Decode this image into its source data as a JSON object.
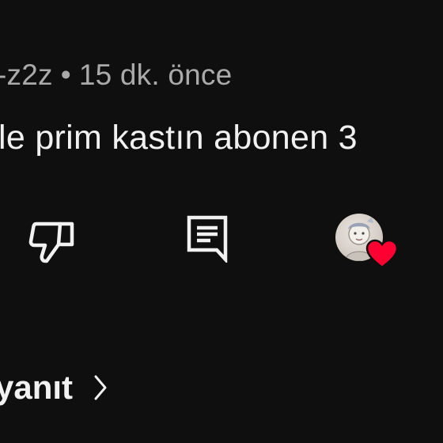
{
  "comment": {
    "author": "-z2z",
    "separator": "•",
    "time": "15 dk. önce",
    "text": "le prim kastın abonen 3"
  },
  "actions": {
    "dislike_icon": "thumbs-down-icon",
    "reply_icon": "comment-icon",
    "creator_heart_icon": "heart-icon",
    "heart_color": "#ff0033"
  },
  "replies": {
    "label": "yanıt",
    "chevron_icon": "chevron-right-icon"
  },
  "colors": {
    "background": "#0f0f0f",
    "text_primary": "#f1f1f1",
    "text_secondary": "#aaaaaa"
  }
}
